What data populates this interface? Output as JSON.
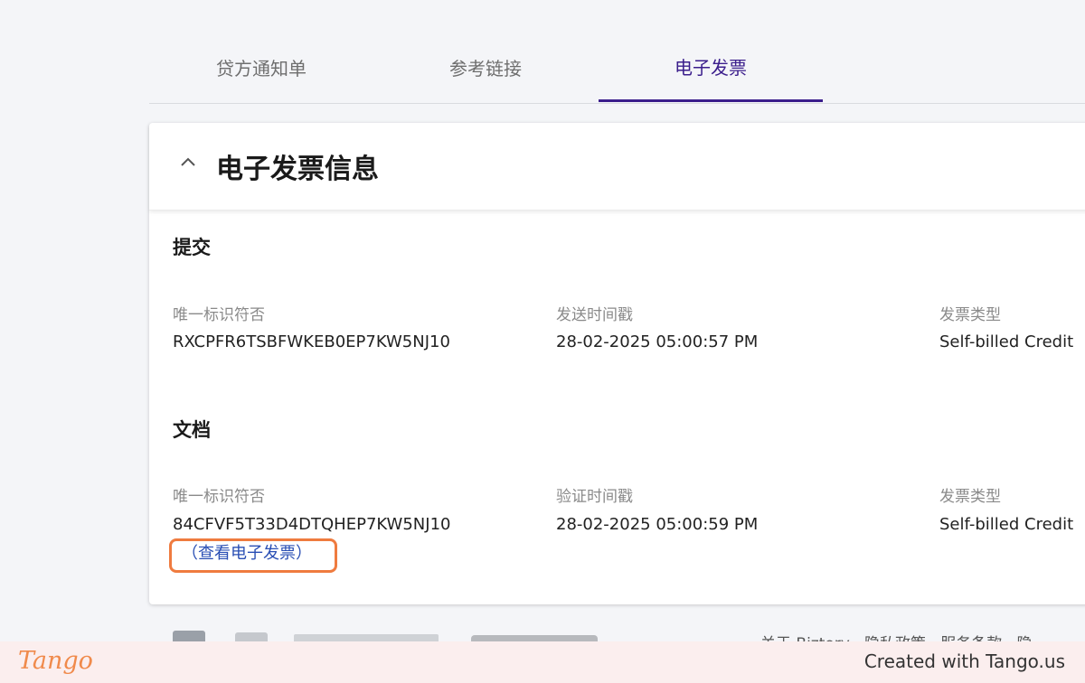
{
  "tabs": [
    {
      "label": "贷方通知单"
    },
    {
      "label": "参考链接"
    },
    {
      "label": "电子发票"
    }
  ],
  "card": {
    "title": "电子发票信息",
    "submit": {
      "title": "提交",
      "uid_label": "唯一标识符否",
      "uid_value": "RXCPFR6TSBFWKEB0EP7KW5NJ10",
      "time_label": "发送时间戳",
      "time_value": "28-02-2025 05:00:57 PM",
      "type_label": "发票类型",
      "type_value": "Self-billed Credit"
    },
    "document": {
      "title": "文档",
      "uid_label": "唯一标识符否",
      "uid_value": "84CFVF5T33D4DTQHEP7KW5NJ10",
      "time_label": "验证时间戳",
      "time_value": "28-02-2025 05:00:59 PM",
      "type_label": "发票类型",
      "type_value": "Self-billed Credit",
      "view_link": "（查看电子发票）"
    }
  },
  "footer": {
    "links": "关于 Biztory · 隐私政策 · 服务条款 · 隐"
  },
  "tango": {
    "logo": "Tango",
    "credit": "Created with Tango.us"
  },
  "colors": {
    "accent": "#3b1e8c",
    "highlight": "#ef7b3f",
    "link": "#2a4fb4"
  }
}
